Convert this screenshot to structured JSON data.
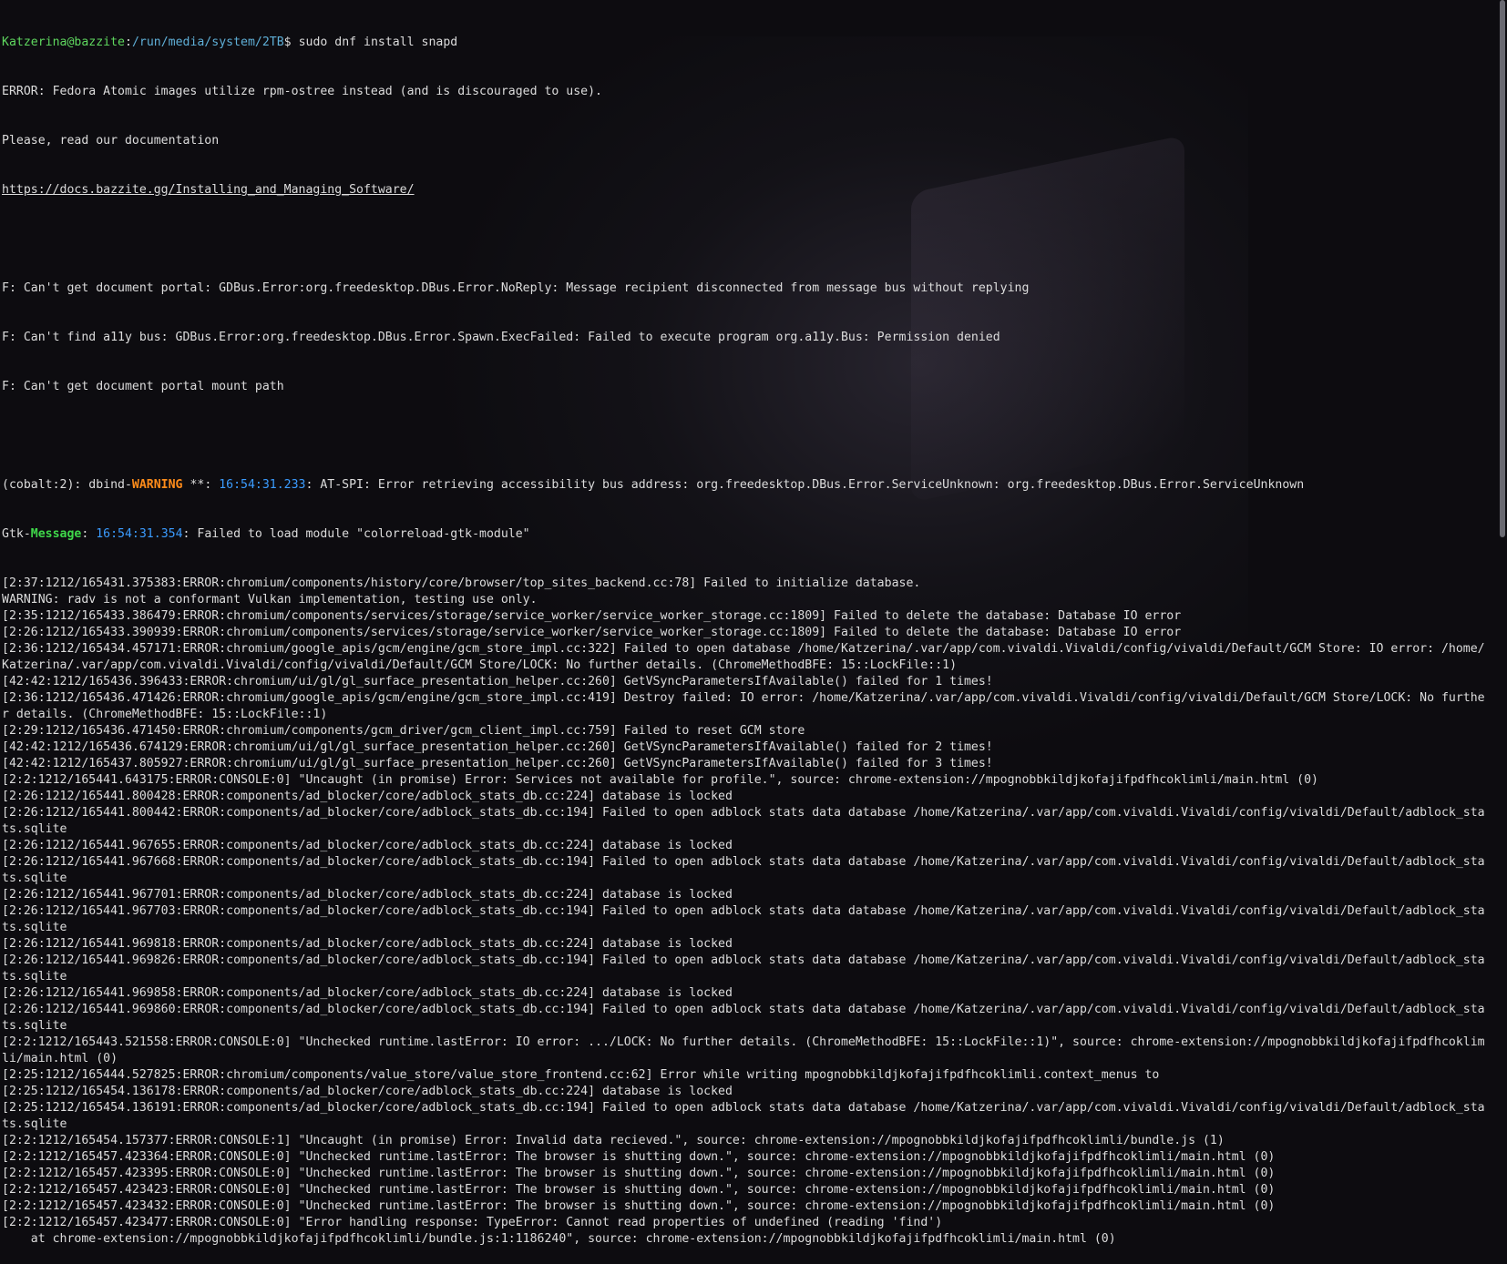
{
  "prompt": {
    "user_host": "Katzerina@bazzite",
    "sep": ":",
    "path": "/run/media/system/2TB",
    "dollar": "$ ",
    "command": "sudo dnf install snapd"
  },
  "lines_top": [
    "ERROR: Fedora Atomic images utilize rpm-ostree instead (and is discouraged to use).",
    "Please, read our documentation"
  ],
  "doc_link": "https://docs.bazzite.gg/Installing_and_Managing_Software/",
  "lines_f": [
    "",
    "F: Can't get document portal: GDBus.Error:org.freedesktop.DBus.Error.NoReply: Message recipient disconnected from message bus without replying",
    "F: Can't find a11y bus: GDBus.Error:org.freedesktop.DBus.Error.Spawn.ExecFailed: Failed to execute program org.a11y.Bus: Permission denied",
    "F: Can't get document portal mount path",
    ""
  ],
  "dbind": {
    "prefix": "(cobalt:2): dbind-",
    "level": "WARNING",
    "stars": " **: ",
    "time": "16:54:31.233",
    "rest": ": AT-SPI: Error retrieving accessibility bus address: org.freedesktop.DBus.Error.ServiceUnknown: org.freedesktop.DBus.Error.ServiceUnknown"
  },
  "gtk": {
    "prefix": "Gtk-",
    "level": "Message",
    "colon": ": ",
    "time": "16:54:31.354",
    "rest": ": Failed to load module \"colorreload-gtk-module\""
  },
  "log_lines": [
    "[2:37:1212/165431.375383:ERROR:chromium/components/history/core/browser/top_sites_backend.cc:78] Failed to initialize database.",
    "WARNING: radv is not a conformant Vulkan implementation, testing use only.",
    "[2:35:1212/165433.386479:ERROR:chromium/components/services/storage/service_worker/service_worker_storage.cc:1809] Failed to delete the database: Database IO error",
    "[2:26:1212/165433.390939:ERROR:chromium/components/services/storage/service_worker/service_worker_storage.cc:1809] Failed to delete the database: Database IO error",
    "[2:36:1212/165434.457171:ERROR:chromium/google_apis/gcm/engine/gcm_store_impl.cc:322] Failed to open database /home/Katzerina/.var/app/com.vivaldi.Vivaldi/config/vivaldi/Default/GCM Store: IO error: /home/",
    "Katzerina/.var/app/com.vivaldi.Vivaldi/config/vivaldi/Default/GCM Store/LOCK: No further details. (ChromeMethodBFE: 15::LockFile::1)",
    "[42:42:1212/165436.396433:ERROR:chromium/ui/gl/gl_surface_presentation_helper.cc:260] GetVSyncParametersIfAvailable() failed for 1 times!",
    "[2:36:1212/165436.471426:ERROR:chromium/google_apis/gcm/engine/gcm_store_impl.cc:419] Destroy failed: IO error: /home/Katzerina/.var/app/com.vivaldi.Vivaldi/config/vivaldi/Default/GCM Store/LOCK: No furthe",
    "r details. (ChromeMethodBFE: 15::LockFile::1)",
    "[2:29:1212/165436.471450:ERROR:chromium/components/gcm_driver/gcm_client_impl.cc:759] Failed to reset GCM store",
    "[42:42:1212/165436.674129:ERROR:chromium/ui/gl/gl_surface_presentation_helper.cc:260] GetVSyncParametersIfAvailable() failed for 2 times!",
    "[42:42:1212/165437.805927:ERROR:chromium/ui/gl/gl_surface_presentation_helper.cc:260] GetVSyncParametersIfAvailable() failed for 3 times!",
    "[2:2:1212/165441.643175:ERROR:CONSOLE:0] \"Uncaught (in promise) Error: Services not available for profile.\", source: chrome-extension://mpognobbkildjkofajifpdfhcoklimli/main.html (0)",
    "[2:26:1212/165441.800428:ERROR:components/ad_blocker/core/adblock_stats_db.cc:224] database is locked",
    "[2:26:1212/165441.800442:ERROR:components/ad_blocker/core/adblock_stats_db.cc:194] Failed to open adblock stats data database /home/Katzerina/.var/app/com.vivaldi.Vivaldi/config/vivaldi/Default/adblock_sta",
    "ts.sqlite",
    "[2:26:1212/165441.967655:ERROR:components/ad_blocker/core/adblock_stats_db.cc:224] database is locked",
    "[2:26:1212/165441.967668:ERROR:components/ad_blocker/core/adblock_stats_db.cc:194] Failed to open adblock stats data database /home/Katzerina/.var/app/com.vivaldi.Vivaldi/config/vivaldi/Default/adblock_sta",
    "ts.sqlite",
    "[2:26:1212/165441.967701:ERROR:components/ad_blocker/core/adblock_stats_db.cc:224] database is locked",
    "[2:26:1212/165441.967703:ERROR:components/ad_blocker/core/adblock_stats_db.cc:194] Failed to open adblock stats data database /home/Katzerina/.var/app/com.vivaldi.Vivaldi/config/vivaldi/Default/adblock_sta",
    "ts.sqlite",
    "[2:26:1212/165441.969818:ERROR:components/ad_blocker/core/adblock_stats_db.cc:224] database is locked",
    "[2:26:1212/165441.969826:ERROR:components/ad_blocker/core/adblock_stats_db.cc:194] Failed to open adblock stats data database /home/Katzerina/.var/app/com.vivaldi.Vivaldi/config/vivaldi/Default/adblock_sta",
    "ts.sqlite",
    "[2:26:1212/165441.969858:ERROR:components/ad_blocker/core/adblock_stats_db.cc:224] database is locked",
    "[2:26:1212/165441.969860:ERROR:components/ad_blocker/core/adblock_stats_db.cc:194] Failed to open adblock stats data database /home/Katzerina/.var/app/com.vivaldi.Vivaldi/config/vivaldi/Default/adblock_sta",
    "ts.sqlite",
    "[2:2:1212/165443.521558:ERROR:CONSOLE:0] \"Unchecked runtime.lastError: IO error: .../LOCK: No further details. (ChromeMethodBFE: 15::LockFile::1)\", source: chrome-extension://mpognobbkildjkofajifpdfhcoklim",
    "li/main.html (0)",
    "[2:25:1212/165444.527825:ERROR:chromium/components/value_store/value_store_frontend.cc:62] Error while writing mpognobbkildjkofajifpdfhcoklimli.context_menus to",
    "[2:25:1212/165454.136178:ERROR:components/ad_blocker/core/adblock_stats_db.cc:224] database is locked",
    "[2:25:1212/165454.136191:ERROR:components/ad_blocker/core/adblock_stats_db.cc:194] Failed to open adblock stats data database /home/Katzerina/.var/app/com.vivaldi.Vivaldi/config/vivaldi/Default/adblock_sta",
    "ts.sqlite",
    "[2:2:1212/165454.157377:ERROR:CONSOLE:1] \"Uncaught (in promise) Error: Invalid data recieved.\", source: chrome-extension://mpognobbkildjkofajifpdfhcoklimli/bundle.js (1)",
    "[2:2:1212/165457.423364:ERROR:CONSOLE:0] \"Unchecked runtime.lastError: The browser is shutting down.\", source: chrome-extension://mpognobbkildjkofajifpdfhcoklimli/main.html (0)",
    "[2:2:1212/165457.423395:ERROR:CONSOLE:0] \"Unchecked runtime.lastError: The browser is shutting down.\", source: chrome-extension://mpognobbkildjkofajifpdfhcoklimli/main.html (0)",
    "[2:2:1212/165457.423423:ERROR:CONSOLE:0] \"Unchecked runtime.lastError: The browser is shutting down.\", source: chrome-extension://mpognobbkildjkofajifpdfhcoklimli/main.html (0)",
    "[2:2:1212/165457.423432:ERROR:CONSOLE:0] \"Unchecked runtime.lastError: The browser is shutting down.\", source: chrome-extension://mpognobbkildjkofajifpdfhcoklimli/main.html (0)",
    "[2:2:1212/165457.423477:ERROR:CONSOLE:0] \"Error handling response: TypeError: Cannot read properties of undefined (reading 'find')",
    "    at chrome-extension://mpognobbkildjkofajifpdfhcoklimli/bundle.js:1:1186240\", source: chrome-extension://mpognobbkildjkofajifpdfhcoklimli/main.html (0)"
  ],
  "colors": {
    "background": "#0d0c10",
    "text": "#dcdcdc",
    "prompt_user": "#5fd75f",
    "prompt_path": "#5fafd7",
    "warning": "#ff8c1a",
    "message": "#3fd84a",
    "timestamp": "#3b9cff"
  }
}
